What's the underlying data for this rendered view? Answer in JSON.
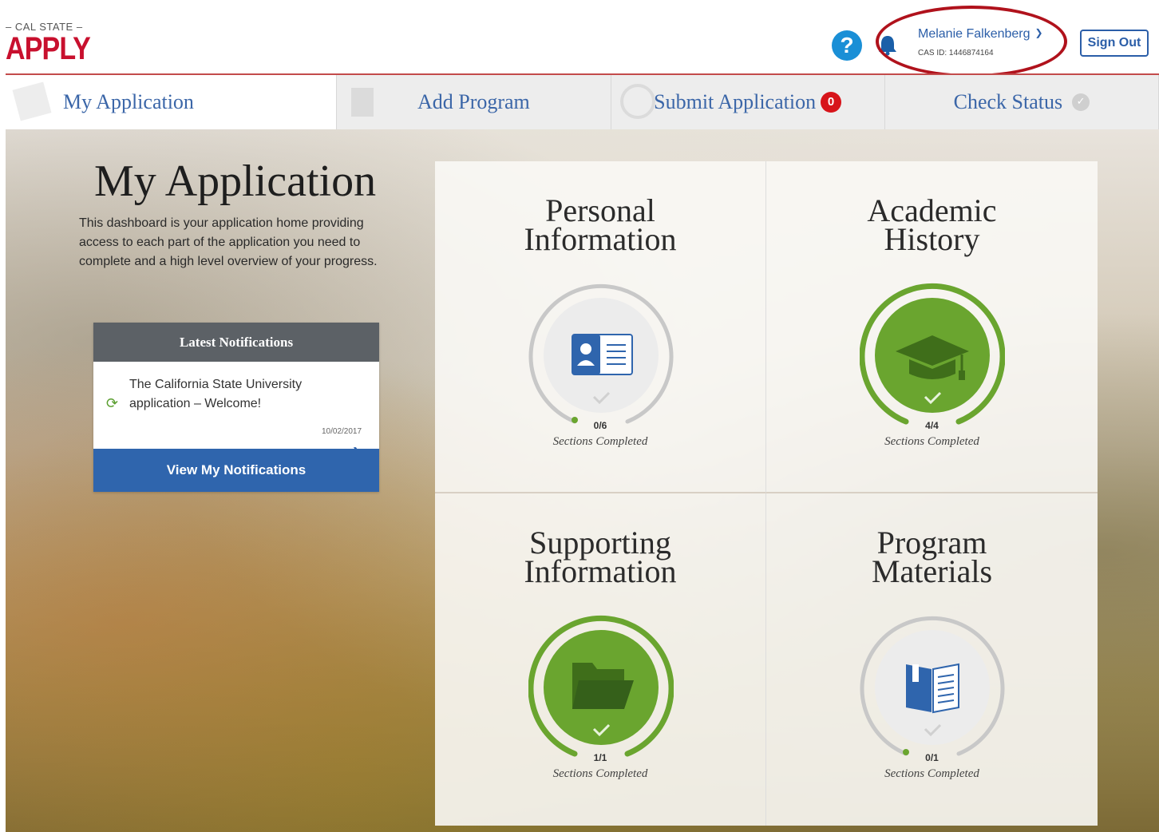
{
  "header": {
    "logo_top": "– CAL STATE –",
    "logo_main": "APPLY",
    "user_name": "Melanie Falkenberg",
    "cas_id": "CAS ID: 1446874164",
    "sign_out": "Sign Out"
  },
  "tabs": [
    {
      "label": "My Application"
    },
    {
      "label": "Add Program"
    },
    {
      "label": "Submit Application",
      "badge": "0"
    },
    {
      "label": "Check Status"
    }
  ],
  "main": {
    "title": "My Application",
    "description": "This dashboard is your application home providing access to each part of the application you need to complete and a high level overview of your progress."
  },
  "notifications": {
    "heading": "Latest Notifications",
    "item_text": "The California State University application – Welcome!",
    "item_date": "10/02/2017",
    "button": "View My Notifications"
  },
  "cards": [
    {
      "title_line1": "Personal",
      "title_line2": "Information",
      "count": "0/6",
      "label": "Sections Completed",
      "progress": 0.0,
      "icon": "id-card-icon"
    },
    {
      "title_line1": "Academic",
      "title_line2": "History",
      "count": "4/4",
      "label": "Sections Completed",
      "progress": 1.0,
      "icon": "graduation-cap-icon"
    },
    {
      "title_line1": "Supporting",
      "title_line2": "Information",
      "count": "1/1",
      "label": "Sections Completed",
      "progress": 1.0,
      "icon": "folder-icon"
    },
    {
      "title_line1": "Program",
      "title_line2": "Materials",
      "count": "0/1",
      "label": "Sections Completed",
      "progress": 0.0,
      "icon": "book-icon"
    }
  ],
  "colors": {
    "accent_blue": "#2f65ad",
    "brand_red": "#c8102e",
    "complete_green": "#6aa52f",
    "badge_red": "#d7141a"
  }
}
